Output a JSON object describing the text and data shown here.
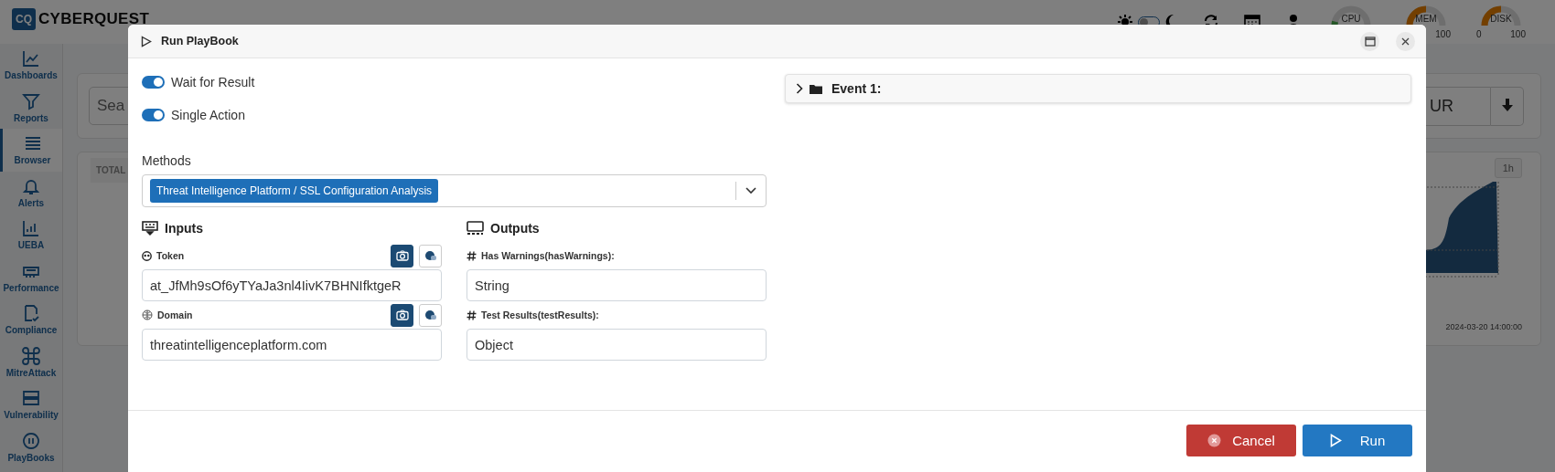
{
  "app": {
    "logo": {
      "mark": "CQ",
      "name": "CYBERQUEST"
    },
    "sidebar": [
      {
        "label": "Dashboards",
        "selected": false
      },
      {
        "label": "Reports",
        "selected": false
      },
      {
        "label": "Browser",
        "selected": true
      },
      {
        "label": "Alerts",
        "selected": false
      },
      {
        "label": "UEBA",
        "selected": false
      },
      {
        "label": "Performance",
        "selected": false
      },
      {
        "label": "Compliance",
        "selected": false
      },
      {
        "label": "MitreAttack",
        "selected": false
      },
      {
        "label": "Vulnerability",
        "selected": false
      },
      {
        "label": "PlayBooks",
        "selected": false
      }
    ],
    "top_bar": {
      "dark_mode": false,
      "gauges": [
        {
          "label": "CPU",
          "level": 0.08
        },
        {
          "label": "MEM",
          "level": 0.5,
          "max": "100"
        },
        {
          "label": "DISK",
          "level": 0.5,
          "min": "0",
          "max": "100"
        }
      ]
    },
    "search": {
      "placeholder": "Sea",
      "range": "UR"
    },
    "stats": {
      "label": "TOTAL",
      "range_button": "1h",
      "x_label": "2024-03-20 14:00:00"
    }
  },
  "dialog": {
    "title": "Run PlayBook",
    "toggles": [
      {
        "label": "Wait for Result",
        "on": true
      },
      {
        "label": "Single Action",
        "on": true
      }
    ],
    "methods": {
      "label": "Methods",
      "selected_values": [
        "Threat Intelligence Platform / SSL Configuration Analysis"
      ]
    },
    "inputs": {
      "title": "Inputs",
      "fields": [
        {
          "label": "Token",
          "value": "at_JfMh9sOf6yTYaJa3nl4IivK7BHNIfktgeR",
          "modes": [
            {
              "selected": true
            },
            {
              "selected": false
            }
          ]
        },
        {
          "label": "Domain",
          "value": "threatintelligenceplatform.com",
          "modes": [
            {
              "selected": true
            },
            {
              "selected": false
            }
          ]
        }
      ]
    },
    "outputs": {
      "title": "Outputs",
      "fields": [
        {
          "label": "Has Warnings(hasWarnings):",
          "value": "String"
        },
        {
          "label": "Test Results(testResults):",
          "value": "Object"
        }
      ]
    },
    "events": [
      {
        "label": "Event 1:",
        "expanded": false
      }
    ],
    "buttons": {
      "cancel": "Cancel",
      "run": "Run"
    }
  }
}
